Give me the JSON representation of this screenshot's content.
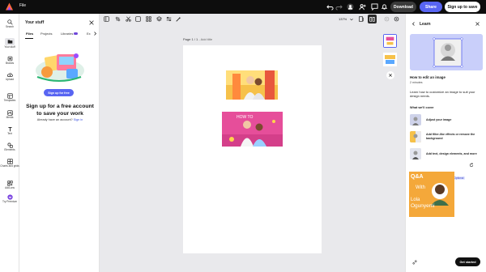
{
  "topbar": {
    "file_label": "File",
    "download_label": "Download",
    "share_label": "Share",
    "signup_label": "Sign up to save",
    "accent": "#5865f2"
  },
  "rail": {
    "items": [
      {
        "label": "Search",
        "icon": "search-icon"
      },
      {
        "label": "Your stuff",
        "icon": "folder-icon"
      },
      {
        "label": "Brands",
        "icon": "brand-icon"
      },
      {
        "label": "Upload",
        "icon": "cloud-upload-icon"
      },
      {
        "label": "Templates",
        "icon": "templates-icon"
      },
      {
        "label": "Media",
        "icon": "media-icon"
      },
      {
        "label": "Text",
        "icon": "text-icon"
      },
      {
        "label": "Elements",
        "icon": "shapes-icon"
      },
      {
        "label": "Charts and grids",
        "icon": "chart-icon"
      },
      {
        "label": "Add-ons",
        "icon": "add-ons-icon"
      },
      {
        "label": "Try Premium",
        "icon": "premium-icon"
      }
    ]
  },
  "stuff": {
    "title": "Your stuff",
    "tabs": [
      "Files",
      "Projects",
      "Libraries",
      "Ex"
    ],
    "signup_button": "Sign up for free",
    "headline": "Sign up for a free account to save your work",
    "already": "Already have an account?",
    "signin": "Sign in"
  },
  "canvas": {
    "zoom": "137%",
    "page_label": "Page 1 / 1",
    "add_title": "- Add title"
  },
  "learn": {
    "title": "Learn",
    "how_title": "How to edit an image",
    "how_minutes": "2 minutes",
    "how_desc": "Learn how to customize an image to suit your design needs.",
    "cover_head": "What we'll cover",
    "cover_items": [
      "Adjust your image",
      "Add filter-like effects or remove the background",
      "Add text, design elements, and more"
    ],
    "try_label": "Try it with a starter template",
    "optional": "Optional",
    "template_text": {
      "line1": "Q&A",
      "line2": "With",
      "line3": "Lola",
      "line4": "Ogunyemi"
    },
    "get_started": "Get started"
  }
}
